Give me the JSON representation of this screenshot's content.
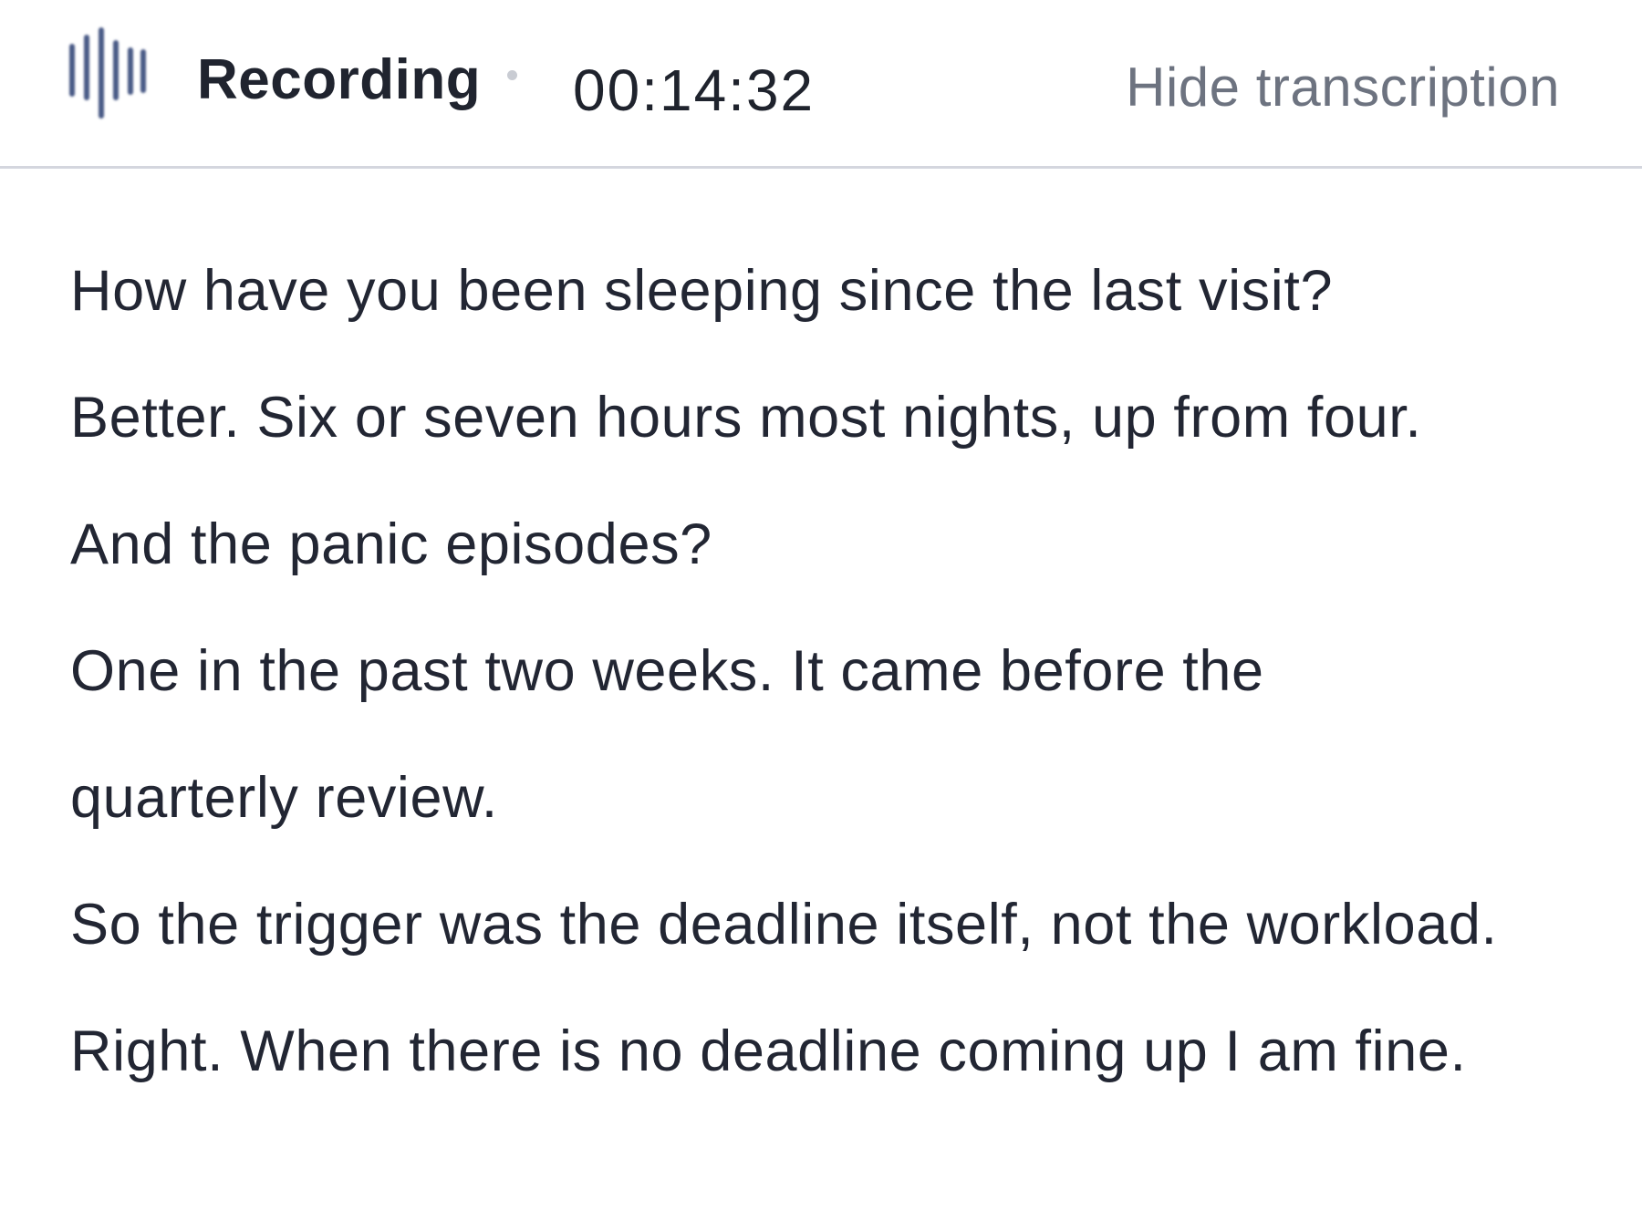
{
  "header": {
    "icon": "waveform-icon",
    "recording_label": "Recording",
    "separator": "•",
    "timer": "00:14:32",
    "hide_button_label": "Hide transcription"
  },
  "transcript": {
    "lines": [
      "How have you been sleeping since the last visit?",
      "Better. Six or seven hours most nights, up from four.",
      "And the panic episodes?",
      "One in the past two weeks. It came before the",
      "quarterly review.",
      "So the trigger was the deadline itself, not the workload.",
      "Right. When there is no deadline coming up I am fine."
    ]
  },
  "colors": {
    "icon": "#4a5a86",
    "text": "#222633",
    "muted": "#6d7380",
    "divider": "#d4d6de",
    "separator_dot": "#c9ccd3"
  }
}
